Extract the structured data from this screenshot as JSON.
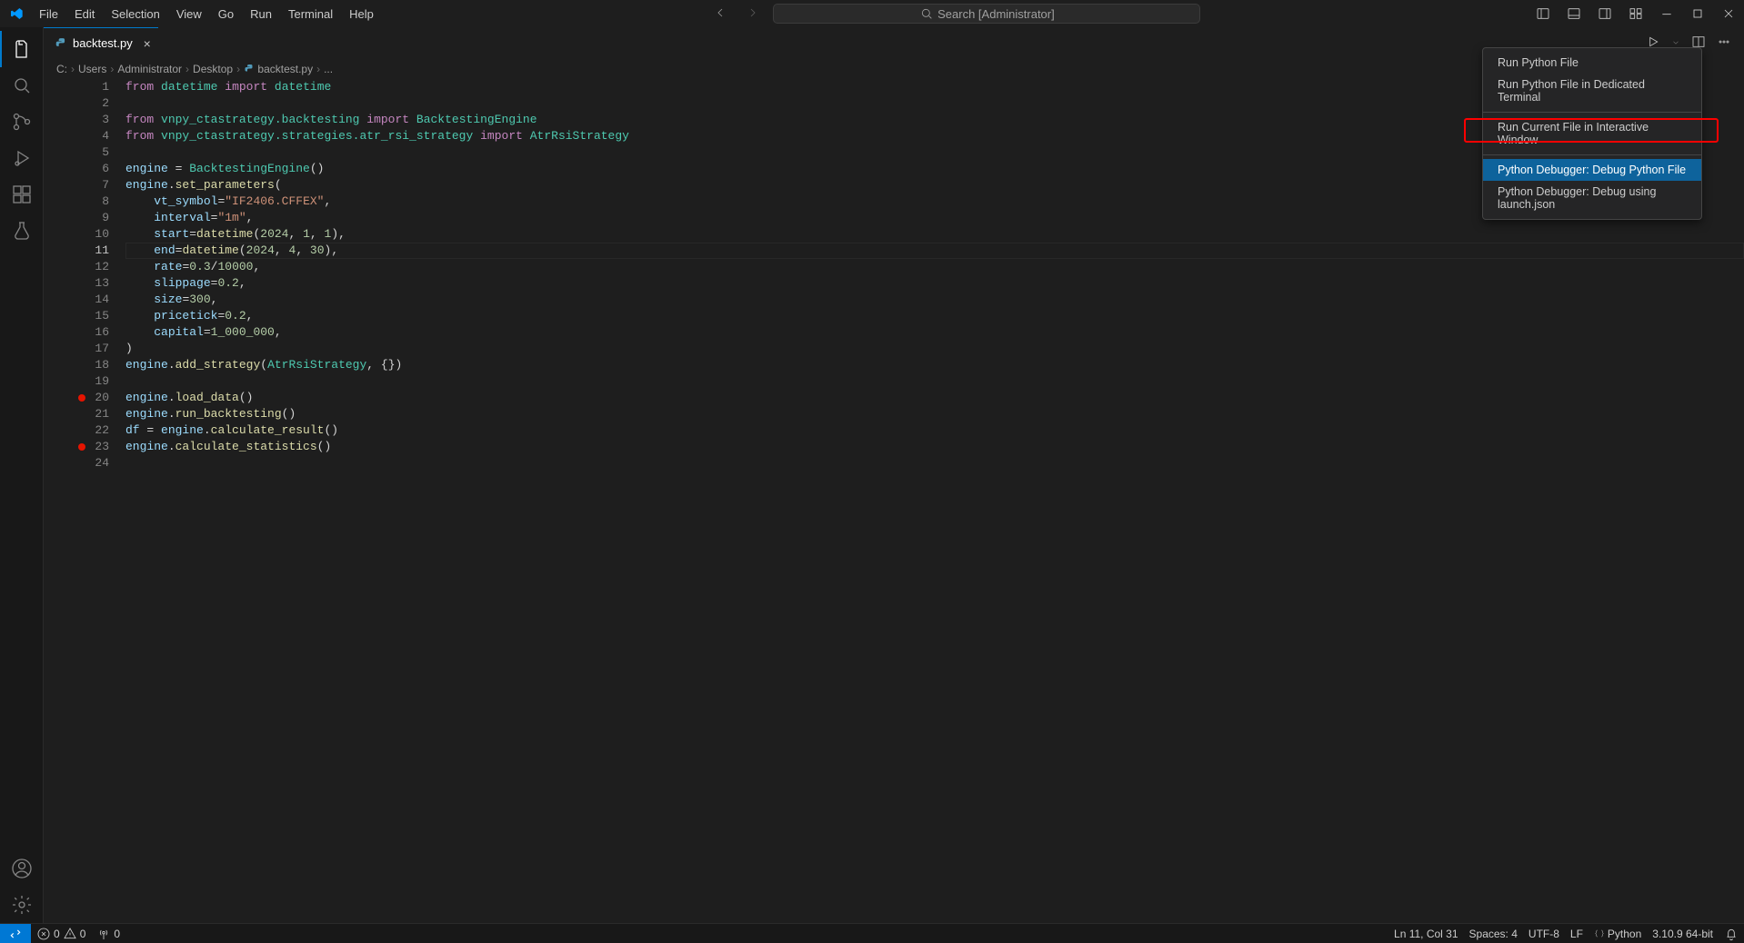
{
  "menu": {
    "items": [
      "File",
      "Edit",
      "Selection",
      "View",
      "Go",
      "Run",
      "Terminal",
      "Help"
    ]
  },
  "search": {
    "placeholder": "Search [Administrator]"
  },
  "tab": {
    "filename": "backtest.py"
  },
  "breadcrumb": {
    "segments": [
      "C:",
      "Users",
      "Administrator",
      "Desktop",
      "backtest.py",
      "..."
    ],
    "file_segment_index": 4
  },
  "tab_actions": {
    "run_icon": "run-icon",
    "dropdown_icon": "chevron-down-icon",
    "split_icon": "split-editor-icon",
    "more_icon": "more-icon"
  },
  "context_menu": {
    "items": [
      {
        "label": "Run Python File",
        "type": "item"
      },
      {
        "label": "Run Python File in Dedicated Terminal",
        "type": "item"
      },
      {
        "type": "sep"
      },
      {
        "label": "Run Current File in Interactive Window",
        "type": "item"
      },
      {
        "type": "sep"
      },
      {
        "label": "Python Debugger: Debug Python File",
        "type": "item",
        "highlight": true
      },
      {
        "label": "Python Debugger: Debug using launch.json",
        "type": "item"
      }
    ]
  },
  "code": {
    "current_line": 11,
    "breakpoints": [
      20,
      23
    ],
    "lines": [
      {
        "n": 1,
        "tokens": [
          [
            "kw",
            "from"
          ],
          [
            "op",
            " "
          ],
          [
            "mod",
            "datetime"
          ],
          [
            "op",
            " "
          ],
          [
            "kw",
            "import"
          ],
          [
            "op",
            " "
          ],
          [
            "mod",
            "datetime"
          ]
        ]
      },
      {
        "n": 2,
        "tokens": []
      },
      {
        "n": 3,
        "tokens": [
          [
            "kw",
            "from"
          ],
          [
            "op",
            " "
          ],
          [
            "mod",
            "vnpy_ctastrategy.backtesting"
          ],
          [
            "op",
            " "
          ],
          [
            "kw",
            "import"
          ],
          [
            "op",
            " "
          ],
          [
            "cls",
            "BacktestingEngine"
          ]
        ]
      },
      {
        "n": 4,
        "tokens": [
          [
            "kw",
            "from"
          ],
          [
            "op",
            " "
          ],
          [
            "mod",
            "vnpy_ctastrategy.strategies.atr_rsi_strategy"
          ],
          [
            "op",
            " "
          ],
          [
            "kw",
            "import"
          ],
          [
            "op",
            " "
          ],
          [
            "cls",
            "AtrRsiStrategy"
          ]
        ]
      },
      {
        "n": 5,
        "tokens": []
      },
      {
        "n": 6,
        "tokens": [
          [
            "var",
            "engine"
          ],
          [
            "op",
            " = "
          ],
          [
            "cls",
            "BacktestingEngine"
          ],
          [
            "pun",
            "()"
          ]
        ]
      },
      {
        "n": 7,
        "tokens": [
          [
            "var",
            "engine"
          ],
          [
            "op",
            "."
          ],
          [
            "fn",
            "set_parameters"
          ],
          [
            "pun",
            "("
          ]
        ]
      },
      {
        "n": 8,
        "tokens": [
          [
            "op",
            "    "
          ],
          [
            "var",
            "vt_symbol"
          ],
          [
            "op",
            "="
          ],
          [
            "str",
            "\"IF2406.CFFEX\""
          ],
          [
            "pun",
            ","
          ]
        ]
      },
      {
        "n": 9,
        "tokens": [
          [
            "op",
            "    "
          ],
          [
            "var",
            "interval"
          ],
          [
            "op",
            "="
          ],
          [
            "str",
            "\"1m\""
          ],
          [
            "pun",
            ","
          ]
        ]
      },
      {
        "n": 10,
        "tokens": [
          [
            "op",
            "    "
          ],
          [
            "var",
            "start"
          ],
          [
            "op",
            "="
          ],
          [
            "fn",
            "datetime"
          ],
          [
            "pun",
            "("
          ],
          [
            "num",
            "2024"
          ],
          [
            "pun",
            ", "
          ],
          [
            "num",
            "1"
          ],
          [
            "pun",
            ", "
          ],
          [
            "num",
            "1"
          ],
          [
            "pun",
            "),"
          ]
        ]
      },
      {
        "n": 11,
        "tokens": [
          [
            "op",
            "    "
          ],
          [
            "var",
            "end"
          ],
          [
            "op",
            "="
          ],
          [
            "fn",
            "datetime"
          ],
          [
            "pun",
            "("
          ],
          [
            "num",
            "2024"
          ],
          [
            "pun",
            ", "
          ],
          [
            "num",
            "4"
          ],
          [
            "pun",
            ", "
          ],
          [
            "num",
            "30"
          ],
          [
            "pun",
            "),"
          ]
        ]
      },
      {
        "n": 12,
        "tokens": [
          [
            "op",
            "    "
          ],
          [
            "var",
            "rate"
          ],
          [
            "op",
            "="
          ],
          [
            "num",
            "0.3"
          ],
          [
            "op",
            "/"
          ],
          [
            "num",
            "10000"
          ],
          [
            "pun",
            ","
          ]
        ]
      },
      {
        "n": 13,
        "tokens": [
          [
            "op",
            "    "
          ],
          [
            "var",
            "slippage"
          ],
          [
            "op",
            "="
          ],
          [
            "num",
            "0.2"
          ],
          [
            "pun",
            ","
          ]
        ]
      },
      {
        "n": 14,
        "tokens": [
          [
            "op",
            "    "
          ],
          [
            "var",
            "size"
          ],
          [
            "op",
            "="
          ],
          [
            "num",
            "300"
          ],
          [
            "pun",
            ","
          ]
        ]
      },
      {
        "n": 15,
        "tokens": [
          [
            "op",
            "    "
          ],
          [
            "var",
            "pricetick"
          ],
          [
            "op",
            "="
          ],
          [
            "num",
            "0.2"
          ],
          [
            "pun",
            ","
          ]
        ]
      },
      {
        "n": 16,
        "tokens": [
          [
            "op",
            "    "
          ],
          [
            "var",
            "capital"
          ],
          [
            "op",
            "="
          ],
          [
            "num",
            "1_000_000"
          ],
          [
            "pun",
            ","
          ]
        ]
      },
      {
        "n": 17,
        "tokens": [
          [
            "pun",
            ")"
          ]
        ]
      },
      {
        "n": 18,
        "tokens": [
          [
            "var",
            "engine"
          ],
          [
            "op",
            "."
          ],
          [
            "fn",
            "add_strategy"
          ],
          [
            "pun",
            "("
          ],
          [
            "cls",
            "AtrRsiStrategy"
          ],
          [
            "pun",
            ", {"
          ],
          [
            "pun",
            "})"
          ]
        ]
      },
      {
        "n": 19,
        "tokens": []
      },
      {
        "n": 20,
        "tokens": [
          [
            "var",
            "engine"
          ],
          [
            "op",
            "."
          ],
          [
            "fn",
            "load_data"
          ],
          [
            "pun",
            "()"
          ]
        ]
      },
      {
        "n": 21,
        "tokens": [
          [
            "var",
            "engine"
          ],
          [
            "op",
            "."
          ],
          [
            "fn",
            "run_backtesting"
          ],
          [
            "pun",
            "()"
          ]
        ]
      },
      {
        "n": 22,
        "tokens": [
          [
            "var",
            "df"
          ],
          [
            "op",
            " = "
          ],
          [
            "var",
            "engine"
          ],
          [
            "op",
            "."
          ],
          [
            "fn",
            "calculate_result"
          ],
          [
            "pun",
            "()"
          ]
        ]
      },
      {
        "n": 23,
        "tokens": [
          [
            "var",
            "engine"
          ],
          [
            "op",
            "."
          ],
          [
            "fn",
            "calculate_statistics"
          ],
          [
            "pun",
            "()"
          ]
        ]
      },
      {
        "n": 24,
        "tokens": []
      }
    ]
  },
  "status": {
    "errors": "0",
    "warnings": "0",
    "ports": "0",
    "cursor": "Ln 11, Col 31",
    "spaces": "Spaces: 4",
    "encoding": "UTF-8",
    "eol": "LF",
    "language": "Python",
    "interpreter": "3.10.9 64-bit"
  }
}
